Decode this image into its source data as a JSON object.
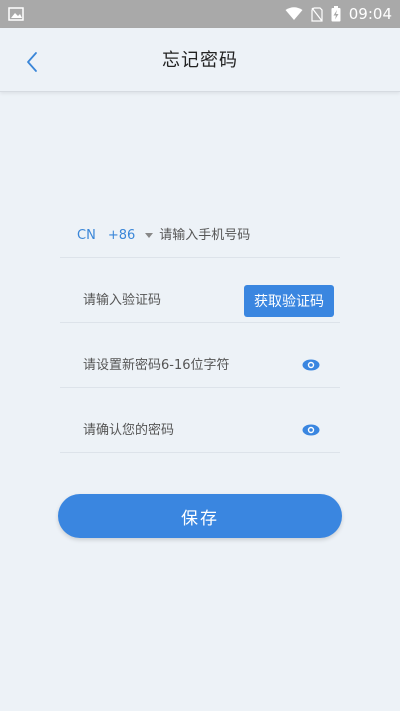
{
  "status_bar": {
    "time": "09:04",
    "icons": [
      "image-icon",
      "wifi-icon",
      "no-sim-icon",
      "battery-charging-icon"
    ]
  },
  "header": {
    "title": "忘记密码",
    "back_icon": "chevron-left-icon"
  },
  "form": {
    "country_code": "CN",
    "dial_code": "+86",
    "phone_placeholder": "请输入手机号码",
    "code_placeholder": "请输入验证码",
    "get_code_label": "获取验证码",
    "new_password_placeholder": "请设置新密码6-16位字符",
    "confirm_password_placeholder": "请确认您的密码",
    "eye_icon": "eye-icon"
  },
  "actions": {
    "save_label": "保存"
  },
  "colors": {
    "accent": "#3a86e0",
    "background": "#edf2f7",
    "status_bar": "#a9a9a9"
  }
}
